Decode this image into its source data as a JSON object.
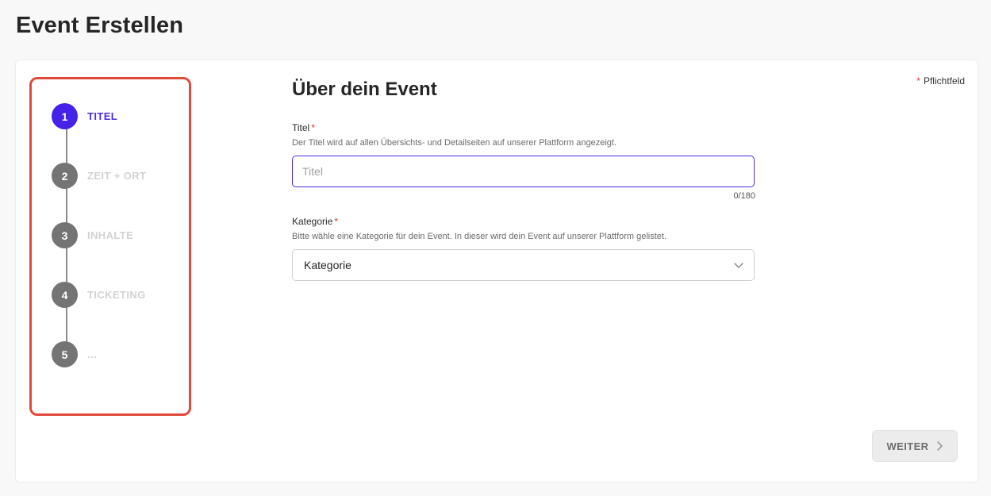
{
  "page": {
    "title": "Event Erstellen"
  },
  "stepper": {
    "steps": [
      {
        "number": "1",
        "label": "TITEL",
        "active": true
      },
      {
        "number": "2",
        "label": "ZEIT + ORT",
        "active": false
      },
      {
        "number": "3",
        "label": "INHALTE",
        "active": false
      },
      {
        "number": "4",
        "label": "TICKETING",
        "active": false
      },
      {
        "number": "5",
        "label": "...",
        "active": false
      }
    ]
  },
  "required_note": {
    "star": "*",
    "text": "Pflichtfeld"
  },
  "form": {
    "title": "Über dein Event",
    "title_field": {
      "label": "Titel",
      "required_mark": "*",
      "help": "Der Titel wird auf allen Übersichts- und Detailseiten auf unserer Plattform angezeigt.",
      "value": "",
      "placeholder": "Titel",
      "counter": "0/180"
    },
    "category_field": {
      "label": "Kategorie",
      "required_mark": "*",
      "help": "Bitte wähle eine Kategorie für dein Event. In dieser wird dein Event auf unserer Plattform gelistet.",
      "selected": "Kategorie"
    }
  },
  "actions": {
    "next_label": "WEITER"
  },
  "colors": {
    "accent": "#4a2ee0",
    "step_inactive": "#747474",
    "highlight_border": "#e04a3a",
    "required": "#dd3333"
  },
  "icons": {
    "chevron": "chevron-down-icon",
    "next": "chevron-right-icon"
  }
}
